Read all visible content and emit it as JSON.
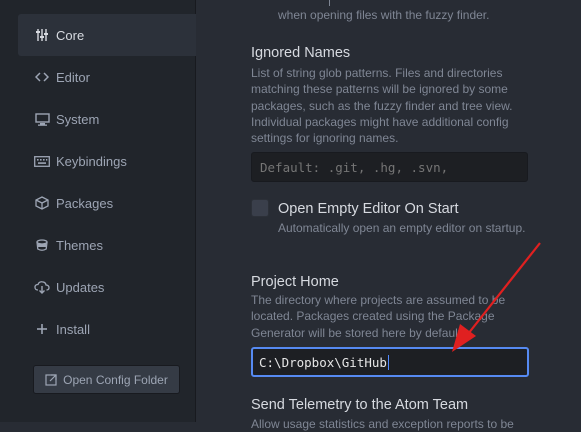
{
  "sidebar": {
    "items": [
      {
        "label": "Core",
        "icon": "settings-sliders-icon",
        "active": true
      },
      {
        "label": "Editor",
        "icon": "code-icon",
        "active": false
      },
      {
        "label": "System",
        "icon": "device-desktop-icon",
        "active": false
      },
      {
        "label": "Keybindings",
        "icon": "keyboard-icon",
        "active": false
      },
      {
        "label": "Packages",
        "icon": "package-icon",
        "active": false
      },
      {
        "label": "Themes",
        "icon": "paintcan-icon",
        "active": false
      },
      {
        "label": "Updates",
        "icon": "cloud-download-icon",
        "active": false
      },
      {
        "label": "Install",
        "icon": "plus-icon",
        "active": false
      }
    ],
    "open_config_label": "Open Config Folder",
    "open_config_icon": "link-external-icon"
  },
  "main": {
    "top_fragment": "when opening files with the fuzzy finder.",
    "ignored_names": {
      "title": "Ignored Names",
      "description": "List of string glob patterns. Files and directories matching these patterns will be ignored by some packages, such as the fuzzy finder and tree view. Individual packages might have additional config settings for ignoring names.",
      "placeholder": "Default: .git, .hg, .svn,"
    },
    "open_empty_editor": {
      "label": "Open Empty Editor On Start",
      "description": "Automatically open an empty editor on startup.",
      "checked": false
    },
    "project_home": {
      "title": "Project Home",
      "description": "The directory where projects are assumed to be located. Packages created using the Package Generator will be stored here by default.",
      "value": "C:\\Dropbox\\GitHub"
    },
    "telemetry": {
      "title": "Send Telemetry to the Atom Team",
      "description": "Allow usage statistics and exception reports to be"
    }
  },
  "colors": {
    "background": "#282c34",
    "sidebar": "#21252b",
    "accent_focus": "#568af2",
    "annotation_arrow": "#e02020"
  }
}
